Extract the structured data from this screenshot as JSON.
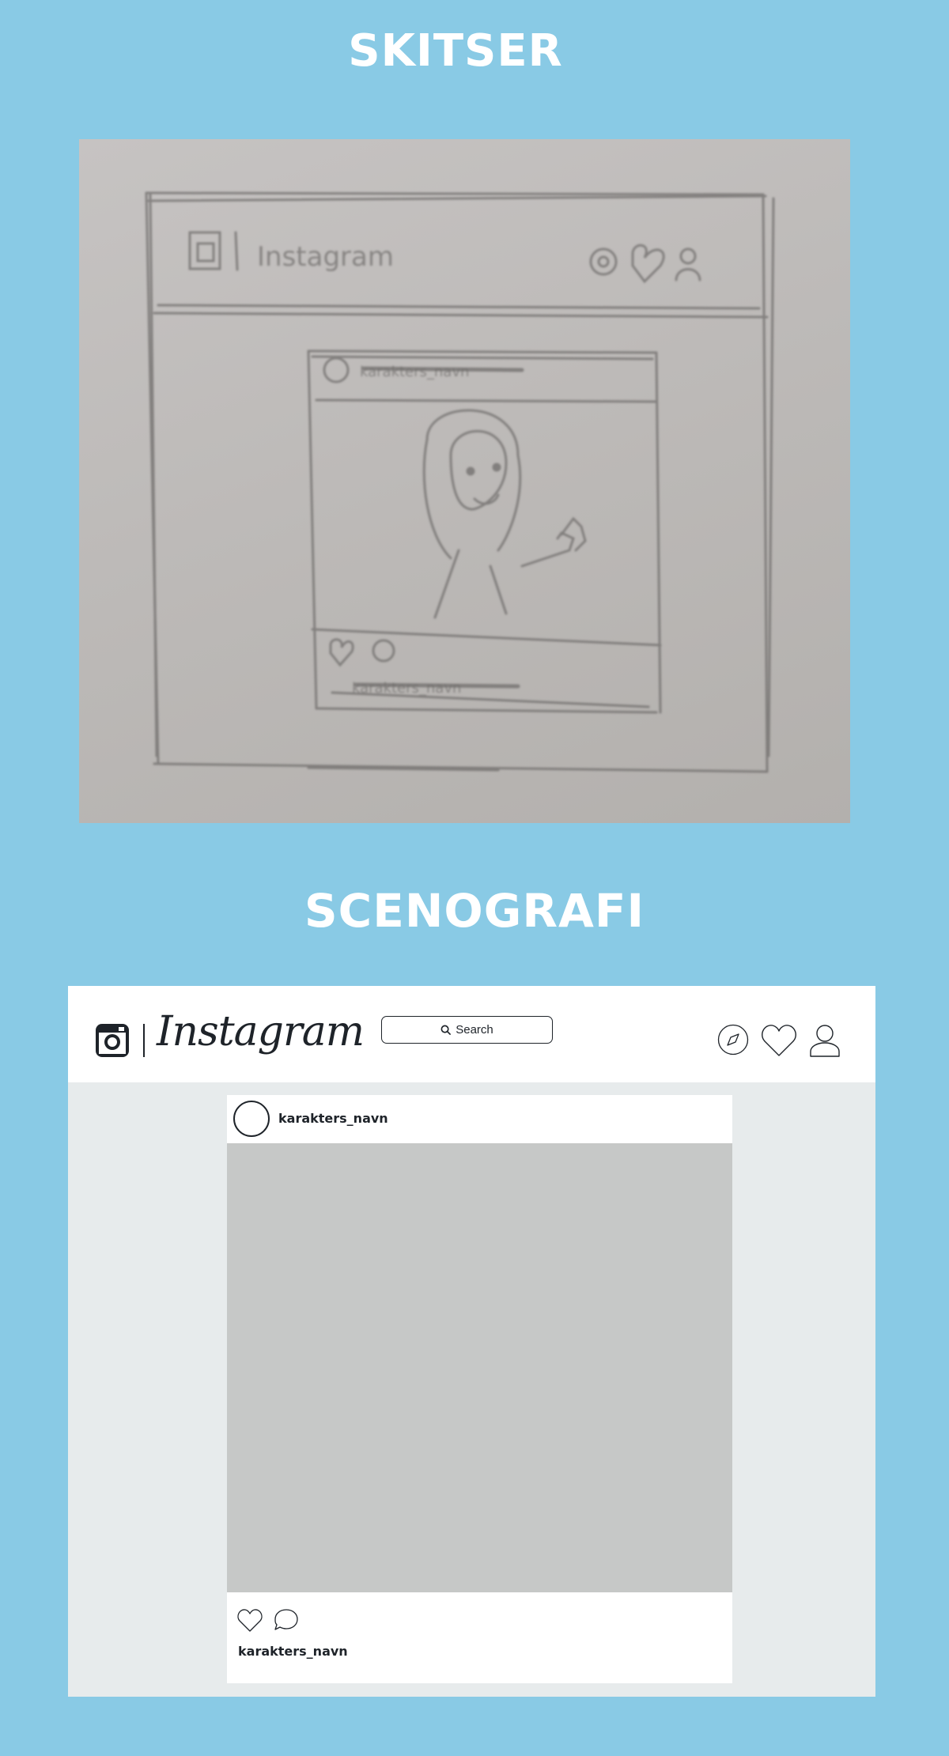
{
  "headings": {
    "sketches": "SKITSER",
    "scenography": "SCENOGRAFI"
  },
  "sketch": {
    "pencil_wordmark": "Instagram",
    "pencil_username_top": "karakters_navn",
    "pencil_username_bottom": "karakters_navn"
  },
  "mockup": {
    "logo_text": "Instagram",
    "search_placeholder": "Search",
    "nav_icons": [
      "explore-icon",
      "heart-icon",
      "profile-icon"
    ],
    "post": {
      "username": "karakters_navn",
      "actions": [
        "heart-icon",
        "comment-icon"
      ],
      "caption_username": "karakters_navn"
    }
  },
  "colors": {
    "background": "#89cae5",
    "header_text": "#ffffff",
    "mock_bg": "#e7ebec",
    "image_placeholder": "#c6c8c7",
    "ink": "#1e2329"
  }
}
